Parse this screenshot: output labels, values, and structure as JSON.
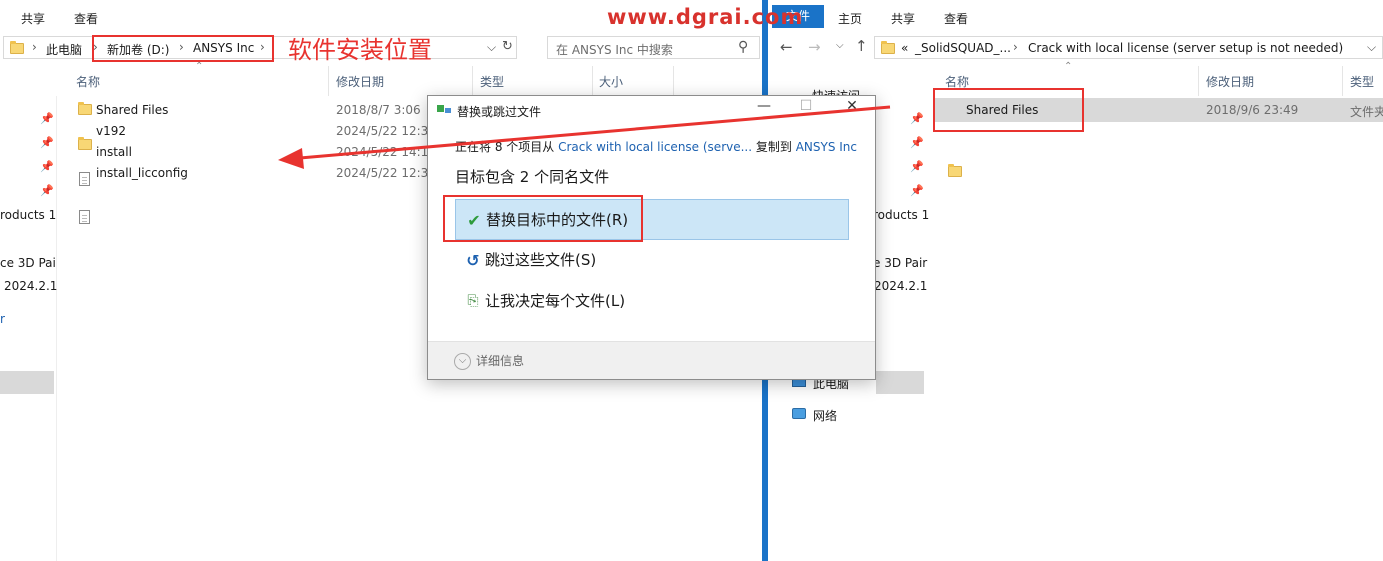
{
  "left_window": {
    "ribbon_tabs": [
      "共享",
      "查看"
    ],
    "breadcrumb": [
      "此电脑",
      "新加卷 (D:)",
      "ANSYS Inc"
    ],
    "search_placeholder": "在 ANSYS Inc 中搜索",
    "columns": [
      "名称",
      "修改日期",
      "类型",
      "大小"
    ],
    "rows": [
      {
        "name": "Shared Files",
        "date": "2018/8/7 3:06",
        "kind": "folder"
      },
      {
        "name": "v192",
        "date": "2024/5/22 12:33",
        "kind": "folder"
      },
      {
        "name": "install",
        "date": "2024/5/22 14:12",
        "kind": "file"
      },
      {
        "name": "install_licconfig",
        "date": "2024/5/22 12:30",
        "kind": "file"
      }
    ],
    "nav_fragments": [
      "roducts 1",
      "ce 3D Pai",
      "2024.2.1",
      "r"
    ]
  },
  "annotation": "软件安装位置",
  "watermark": "www.dgrai.com",
  "right_window": {
    "ribbon_tabs": [
      "文件",
      "主页",
      "共享",
      "查看"
    ],
    "breadcrumb": [
      "_SolidSQUAD_...",
      "Crack with local license (server setup is not needed)"
    ],
    "breadcrumb_prefix": "«",
    "columns": [
      "名称",
      "修改日期",
      "类型"
    ],
    "rows": [
      {
        "name": "Shared Files",
        "date": "2018/9/6 23:49",
        "type": "文件夹"
      }
    ],
    "nav": {
      "quick_access": "快速访问",
      "fragments": [
        "roducts 1",
        "e 3D Pair",
        "2024.2.1"
      ],
      "this_pc": "此电脑",
      "network": "网络"
    }
  },
  "dialog": {
    "title": "替换或跳过文件",
    "line_prefix": "正在将 8 个项目从 ",
    "source": "Crack with local license (serve...",
    "line_mid": " 复制到 ",
    "dest": "ANSYS Inc",
    "heading": "目标包含 2 个同名文件",
    "options": [
      {
        "label": "替换目标中的文件(R)",
        "icon": "check-icon",
        "selected": true
      },
      {
        "label": "跳过这些文件(S)",
        "icon": "skip-icon",
        "selected": false
      },
      {
        "label": "让我决定每个文件(L)",
        "icon": "decide-icon",
        "selected": false
      }
    ],
    "more_info": "详细信息",
    "controls": {
      "minimize": "—",
      "maximize": "☐",
      "close": "✕"
    }
  },
  "colors": {
    "accent_red": "#e8332f",
    "explorer_blue": "#1a73c8",
    "selection": "#cce6f7"
  }
}
